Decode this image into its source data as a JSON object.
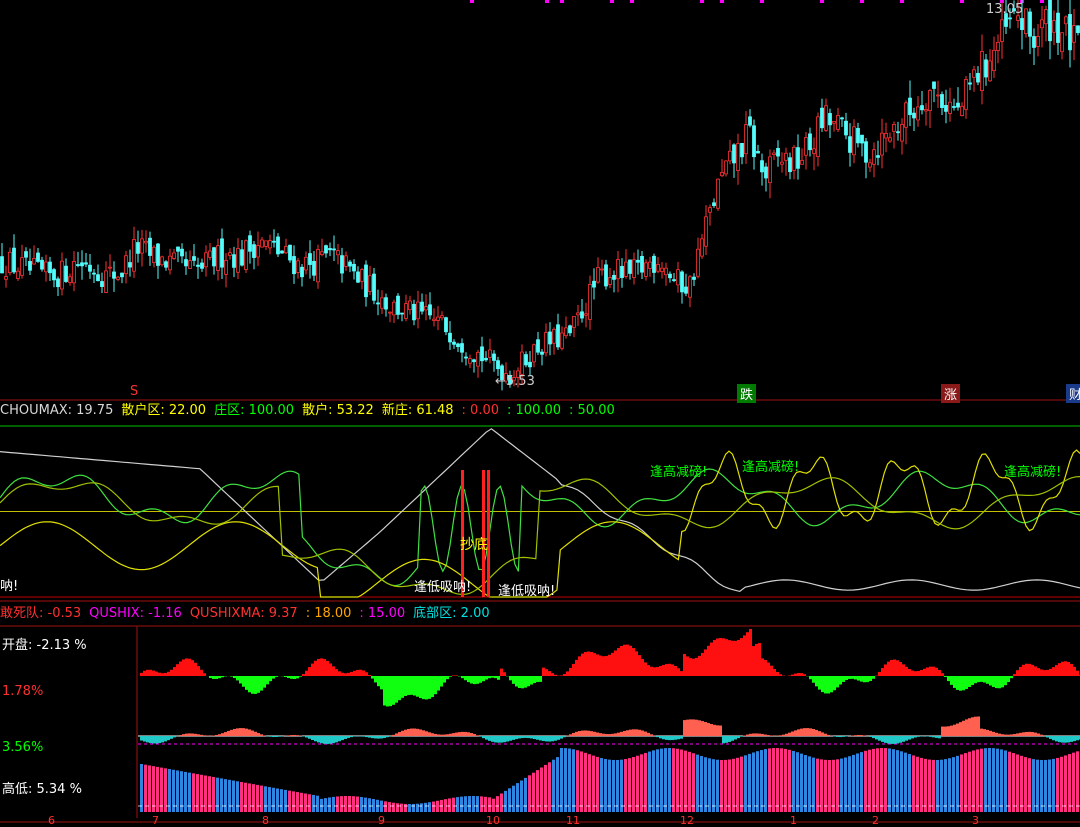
{
  "main": {
    "high_label": "13.05",
    "low_label": "5.53",
    "markers": [
      {
        "text": "S",
        "color": "#ff3030"
      },
      {
        "text": "跌",
        "color": "#ffffff",
        "bg": "#007a00"
      },
      {
        "text": "涨",
        "color": "#ffffff",
        "bg": "#8a1a1a"
      },
      {
        "text": "财",
        "color": "#ffffff",
        "bg": "#1a3a8a"
      }
    ]
  },
  "indicator1": {
    "items": [
      {
        "name": "CHOUMAX",
        "value": ": 19.75",
        "color": "#d8d8d8"
      },
      {
        "name": "散户区",
        "value": ": 22.00",
        "color": "#ffff00"
      },
      {
        "name": "庄区",
        "value": ": 100.00",
        "color": "#00ff00"
      },
      {
        "name": "散户",
        "value": ": 53.22",
        "color": "#ffff00"
      },
      {
        "name": "新庄",
        "value": ": 61.48",
        "color": "#ffff00"
      },
      {
        "name": "",
        "value": ": 0.00",
        "color": "#ff3030"
      },
      {
        "name": "",
        "value": ": 100.00",
        "color": "#00ff00"
      },
      {
        "name": "",
        "value": ": 50.00",
        "color": "#00ff00"
      }
    ],
    "annotations": {
      "left_cut": "呐!",
      "chaodi": "抄底",
      "low_absorb_1": "逢低吸呐!",
      "low_absorb_2": "逢低吸呐!",
      "high_reduce_1": "逢高减磅!",
      "high_reduce_2": "逢高减磅!",
      "high_reduce_3": "逢高减磅!"
    }
  },
  "indicator2": {
    "items": [
      {
        "name": "敢死队",
        "value": ": -0.53",
        "color": "#ff3030"
      },
      {
        "name": "QUSHIX",
        "value": ": -1.16",
        "color": "#ff00ff"
      },
      {
        "name": "QUSHIXMA",
        "value": ": 9.37",
        "color": "#ff3030"
      },
      {
        "name": "",
        "value": ": 18.00",
        "color": "#ffa500"
      },
      {
        "name": "",
        "value": ": 15.00",
        "color": "#ff00ff"
      },
      {
        "name": "底部区",
        "value": ": 2.00",
        "color": "#00e0e0"
      }
    ],
    "side": [
      {
        "label": "开盘:",
        "value": "-2.13 %",
        "color": "#ffffff"
      },
      {
        "label": "",
        "value": "1.78%",
        "color": "#ff3030"
      },
      {
        "label": "",
        "value": "3.56%",
        "color": "#00ff00"
      },
      {
        "label": "高低:",
        "value": "5.34 %",
        "color": "#ffffff"
      }
    ]
  },
  "dates": [
    "6",
    "7",
    "8",
    "9",
    "10",
    "11",
    "12",
    "1",
    "2",
    "3"
  ],
  "chart_data": {
    "type": "candlestick",
    "price_high": 13.05,
    "price_low": 5.53,
    "close_path": [
      7.9,
      7.8,
      7.7,
      7.6,
      7.65,
      7.9,
      7.8,
      7.6,
      7.7,
      8.2,
      8.0,
      7.9,
      7.8,
      7.7,
      7.9,
      8.1,
      8.0,
      8.3,
      8.2,
      8.0,
      7.8,
      7.9,
      8.0,
      7.8,
      7.5,
      7.3,
      7.0,
      6.9,
      6.8,
      6.7,
      6.5,
      6.2,
      6.0,
      5.8,
      5.6,
      5.9,
      6.2,
      6.3,
      6.4,
      7.0,
      7.6,
      7.7,
      7.6,
      7.8,
      8.0,
      7.5,
      7.4,
      8.5,
      9.5,
      10.0,
      10.5,
      9.6,
      10.0,
      9.9,
      10.2,
      10.8,
      10.6,
      10.3,
      10.1,
      10.4,
      10.7,
      11.0,
      11.4,
      11.2,
      10.9,
      11.6,
      12.0,
      12.5,
      12.9,
      12.4,
      12.8,
      12.6,
      12.2
    ]
  }
}
